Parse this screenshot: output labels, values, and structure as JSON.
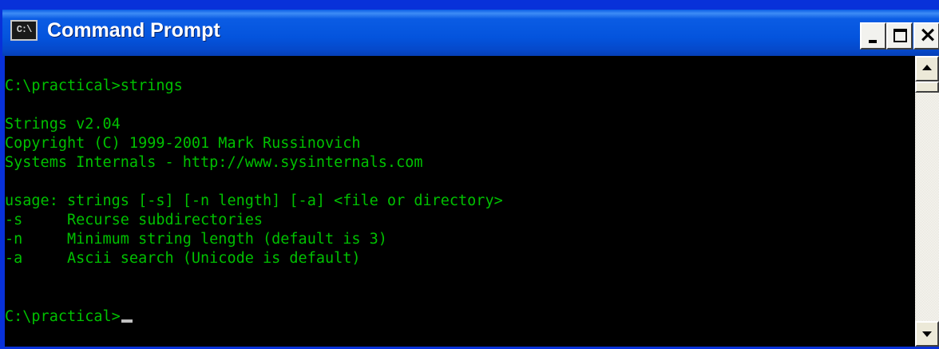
{
  "window": {
    "title": "Command Prompt",
    "icon": "cmd-console-icon",
    "icon_text": "C:\\",
    "controls": {
      "minimize": "minimize-icon",
      "maximize": "maximize-icon",
      "close": "close-icon"
    },
    "colors": {
      "titlebar": "#0454dd",
      "console_background": "#000000",
      "console_text": "#00c000"
    }
  },
  "console": {
    "lines": [
      "C:\\practical>strings",
      "",
      "Strings v2.04",
      "Copyright (C) 1999-2001 Mark Russinovich",
      "Systems Internals - http://www.sysinternals.com",
      "",
      "usage: strings [-s] [-n length] [-a] <file or directory>",
      "-s     Recurse subdirectories",
      "-n     Minimum string length (default is 3)",
      "-a     Ascii search (Unicode is default)",
      "",
      "",
      "C:\\practical>"
    ],
    "cursor": "_"
  },
  "scrollbar": {
    "up_icon": "arrow-up-icon",
    "down_icon": "arrow-down-icon"
  }
}
